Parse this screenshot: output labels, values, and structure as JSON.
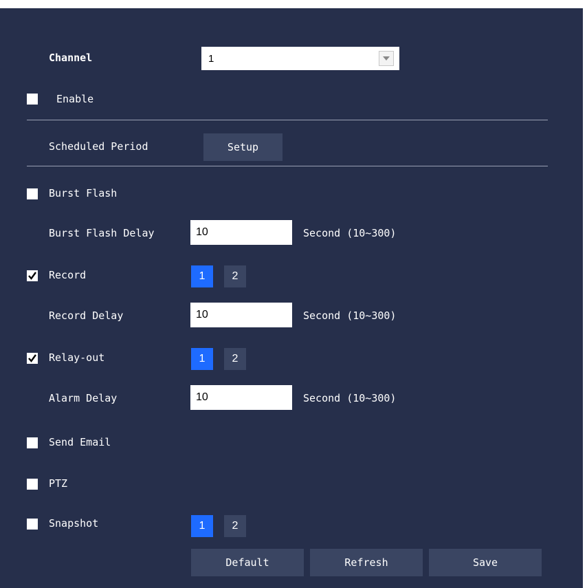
{
  "channel": {
    "label": "Channel",
    "value": "1"
  },
  "enable": {
    "label": "Enable",
    "checked": false
  },
  "scheduled_period": {
    "label": "Scheduled Period",
    "button": "Setup"
  },
  "burst_flash": {
    "label": "Burst Flash",
    "checked": false
  },
  "burst_flash_delay": {
    "label": "Burst Flash Delay",
    "value": "10",
    "unit": "Second (10~300)"
  },
  "record": {
    "label": "Record",
    "checked": true,
    "channels": [
      "1",
      "2"
    ]
  },
  "record_delay": {
    "label": "Record Delay",
    "value": "10",
    "unit": "Second (10~300)"
  },
  "relay_out": {
    "label": "Relay-out",
    "checked": true,
    "channels": [
      "1",
      "2"
    ]
  },
  "alarm_delay": {
    "label": "Alarm Delay",
    "value": "10",
    "unit": "Second (10~300)"
  },
  "send_email": {
    "label": "Send Email",
    "checked": false
  },
  "ptz": {
    "label": "PTZ",
    "checked": false
  },
  "snapshot": {
    "label": "Snapshot",
    "checked": false,
    "channels": [
      "1",
      "2"
    ]
  },
  "buttons": {
    "default": "Default",
    "refresh": "Refresh",
    "save": "Save"
  },
  "colors": {
    "background": "#262f4b",
    "accent": "#1e6bff",
    "button": "#3a4562"
  },
  "icons": {
    "checkmark": "check-icon",
    "dropdown": "chevron-down-icon"
  }
}
